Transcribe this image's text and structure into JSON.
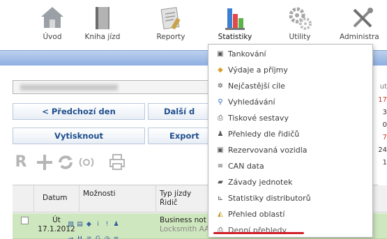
{
  "nav": [
    {
      "label": "Úvod",
      "icon": "home-icon"
    },
    {
      "label": "Kniha jízd",
      "icon": "book-icon"
    },
    {
      "label": "Reporty",
      "icon": "report-icon"
    },
    {
      "label": "Statistiky",
      "icon": "chart-icon"
    },
    {
      "label": "Utility",
      "icon": "gear-icon"
    },
    {
      "label": "Administra",
      "icon": "tools-icon"
    }
  ],
  "buttons": {
    "prev_day": "< Předchozí den",
    "next_day": "Další d",
    "print": "Vytisknout",
    "export": "Export"
  },
  "toolbar_icons": [
    "r-icon",
    "crosshair-icon",
    "refresh-icon",
    "signal-icon",
    "printer-icon"
  ],
  "table": {
    "headers": {
      "date": "Datum",
      "options": "Možnosti",
      "trip_type": "Typ jízdy",
      "driver": "Řidič"
    },
    "row": {
      "day": "Út",
      "date": "17.1.2012",
      "trip_type": "Business not a",
      "driver": "Locksmith AAA"
    }
  },
  "right_clip": [
    "ut",
    "17",
    "3",
    "0",
    "7",
    "24",
    "1"
  ],
  "menu": [
    {
      "label": "Tankování",
      "icon": "fuel-icon"
    },
    {
      "label": "Výdaje a příjmy",
      "icon": "money-icon"
    },
    {
      "label": "Nejčastější cíle",
      "icon": "target-icon"
    },
    {
      "label": "Vyhledávání",
      "icon": "search-icon"
    },
    {
      "label": "Tiskové sestavy",
      "icon": "printer-icon"
    },
    {
      "label": "Přehledy dle řidičů",
      "icon": "person-icon"
    },
    {
      "label": "Rezervovaná vozidla",
      "icon": "reservation-icon"
    },
    {
      "label": "CAN data",
      "icon": "can-icon"
    },
    {
      "label": "Závady jednotek",
      "icon": "car-icon"
    },
    {
      "label": "Statistiky distributorů",
      "icon": "stats-icon"
    },
    {
      "label": "Přehled oblastí",
      "icon": "area-icon"
    },
    {
      "label": "Denní přehledy",
      "icon": "daily-icon"
    }
  ],
  "colors": {
    "accent": "#1f4f8d",
    "row_highlight": "#cfe7be",
    "underline": "#d11f2a",
    "band": "#8eaee2"
  }
}
